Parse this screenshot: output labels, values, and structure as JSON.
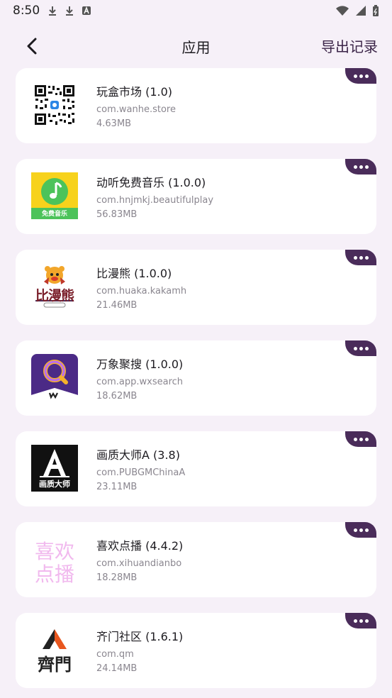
{
  "status": {
    "time": "8:50",
    "left_icons": [
      "download-icon",
      "download-icon",
      "text-a-icon"
    ],
    "right_icons": [
      "wifi-icon",
      "signal-icon",
      "battery-icon"
    ]
  },
  "header": {
    "title": "应用",
    "export_label": "导出记录"
  },
  "apps": [
    {
      "name": "玩盒市场 (1.0)",
      "package": "com.wanhe.store",
      "size": "4.63MB",
      "icon": "qr-code-icon"
    },
    {
      "name": "动听免费音乐 (1.0.0)",
      "package": "com.hnjmkj.beautifulplay",
      "size": "56.83MB",
      "icon": "music-note-icon",
      "icon_text": "免费音乐"
    },
    {
      "name": "比漫熊 (1.0.0)",
      "package": "com.huaka.kakamh",
      "size": "21.46MB",
      "icon": "bear-logo-icon",
      "icon_text": "比漫熊"
    },
    {
      "name": "万象聚搜 (1.0.0)",
      "package": "com.app.wxsearch",
      "size": "18.62MB",
      "icon": "search-logo-icon"
    },
    {
      "name": "画质大师A (3.8)",
      "package": "com.PUBGMChinaA",
      "size": "23.11MB",
      "icon": "letter-a-logo-icon",
      "icon_text": "画质大师"
    },
    {
      "name": "喜欢点播 (4.4.2)",
      "package": "com.xihuandianbo",
      "size": "18.28MB",
      "icon": "text-logo-icon",
      "icon_text_1": "喜欢",
      "icon_text_2": "点播"
    },
    {
      "name": "齐门社区 (1.6.1)",
      "package": "com.qm",
      "size": "24.14MB",
      "icon": "qimen-logo-icon",
      "icon_text": "齊門"
    }
  ]
}
